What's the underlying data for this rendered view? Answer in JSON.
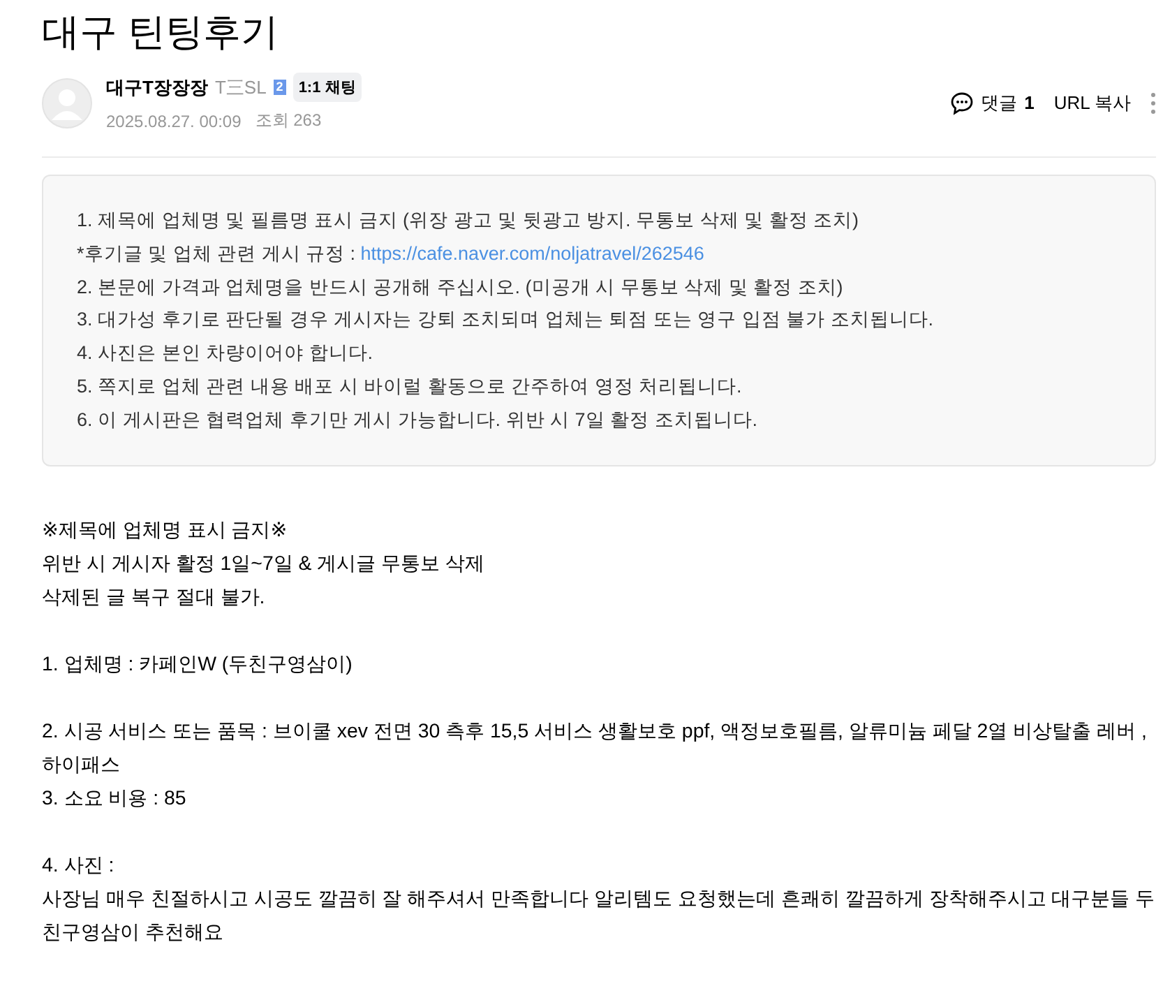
{
  "title": "대구 틴팅후기",
  "author": {
    "name": "대구T장장장",
    "tag": "T三SL",
    "level": "2",
    "chat_button": "1:1 채팅",
    "date": "2025.08.27. 00:09",
    "views_label": "조회",
    "views": "263"
  },
  "actions": {
    "comments_label": "댓글",
    "comments": "1",
    "copy_url": "URL 복사"
  },
  "notice": [
    {
      "text": "1. 제목에 업체명 및 필름명 표시 금지 (위장 광고 및 뒷광고 방지. 무통보 삭제 및 활정 조치)"
    },
    {
      "text": "*후기글 및 업체 관련 게시 규정 : ",
      "link": "https://cafe.naver.com/noljatravel/262546"
    },
    {
      "text": "2. 본문에 가격과 업체명을 반드시 공개해 주십시오. (미공개 시 무통보 삭제 및 활정 조치)"
    },
    {
      "text": "3. 대가성 후기로 판단될 경우 게시자는 강퇴 조치되며 업체는 퇴점 또는 영구 입점 불가 조치됩니다."
    },
    {
      "text": "4. 사진은 본인 차량이어야 합니다."
    },
    {
      "text": "5. 쪽지로 업체 관련 내용 배포 시 바이럴 활동으로 간주하여 영정 처리됩니다."
    },
    {
      "text": "6. 이 게시판은 협력업체 후기만 게시 가능합니다. 위반 시 7일 활정 조치됩니다."
    }
  ],
  "body": [
    [
      "※제목에 업체명 표시 금지※",
      "위반 시 게시자 활정 1일~7일 & 게시글 무통보 삭제",
      "삭제된 글 복구 절대 불가."
    ],
    [
      "1. 업체명 :  카페인W (두친구영삼이)"
    ],
    [
      "2. 시공 서비스 또는 품목 :  브이쿨 xev 전면 30 측후 15,5 서비스 생활보호 ppf, 액정보호필름, 알류미늄 페달 2열 비상탈출 레버 ,하이패스",
      "3. 소요 비용 :  85"
    ],
    [
      "4. 사진 :",
      "사장님 매우 친절하시고 시공도 깔끔히 잘 해주셔서 만족합니다 알리템도 요청했는데 흔쾌히 깔끔하게 장착해주시고 대구분들 두친구영삼이 추천해요"
    ]
  ]
}
